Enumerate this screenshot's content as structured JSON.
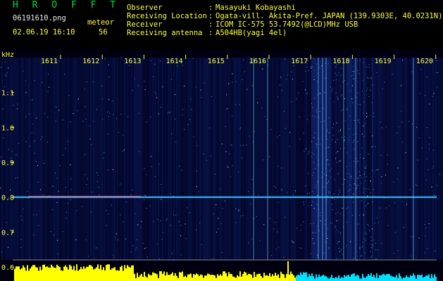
{
  "header": {
    "logo": "H R O F F T",
    "filename": "06191610.png",
    "meteor_label": "meteor",
    "datetime": "02.06.19 16:10",
    "meteor_count": "56"
  },
  "observer_info": [
    {
      "label": "Observer",
      "value": "Masayuki Kobayashi"
    },
    {
      "label": "Receiving Location",
      "value": "Ogata-vill. Akita-Pref. JAPAN (139.9303E, 40.0231N)"
    },
    {
      "label": "Receiver",
      "value": "ICOM IC-575 53.7492(@LCD)MHz USB"
    },
    {
      "label": "Receiving antenna",
      "value": "A504HB(yagi 4el)"
    }
  ],
  "chart_data": {
    "type": "heatmap",
    "ylabel": "kHz",
    "yticks": [
      "1.1",
      "1.0",
      "0.9",
      "0.8",
      "0.7",
      "0.6"
    ],
    "xticks": [
      "1611",
      "1612",
      "1613",
      "1614",
      "1615",
      "1616",
      "1617",
      "1618",
      "1619",
      "1620"
    ],
    "carrier_freq_khz": 0.8,
    "meteor_count": 56
  },
  "colors": {
    "label": "#ffff40",
    "logo": "#00e040",
    "text": "#e8e8e8",
    "background": "#000010",
    "carrier": "#40c0ff",
    "spectrum_bars": "#ffff00",
    "cyan_bars": "#00e0ff"
  }
}
